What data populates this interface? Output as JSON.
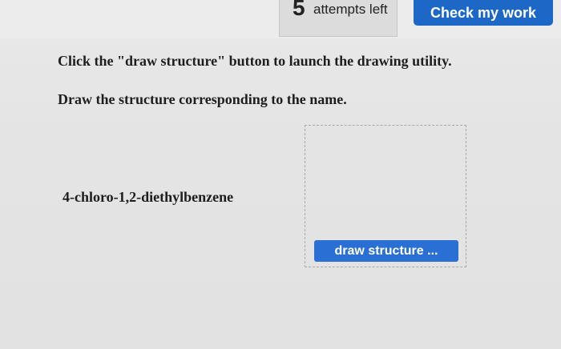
{
  "header": {
    "attempts_count": "5",
    "attempts_label": "attempts left",
    "check_button_label": "Check my work"
  },
  "instructions": {
    "line1": "Click the \"draw structure\" button to launch the drawing utility.",
    "line2": "Draw the structure corresponding to the name."
  },
  "question": {
    "compound_name": "4-chloro-1,2-diethylbenzene"
  },
  "structure": {
    "draw_button_label": "draw structure ..."
  },
  "colors": {
    "accent": "#1d67c7"
  }
}
